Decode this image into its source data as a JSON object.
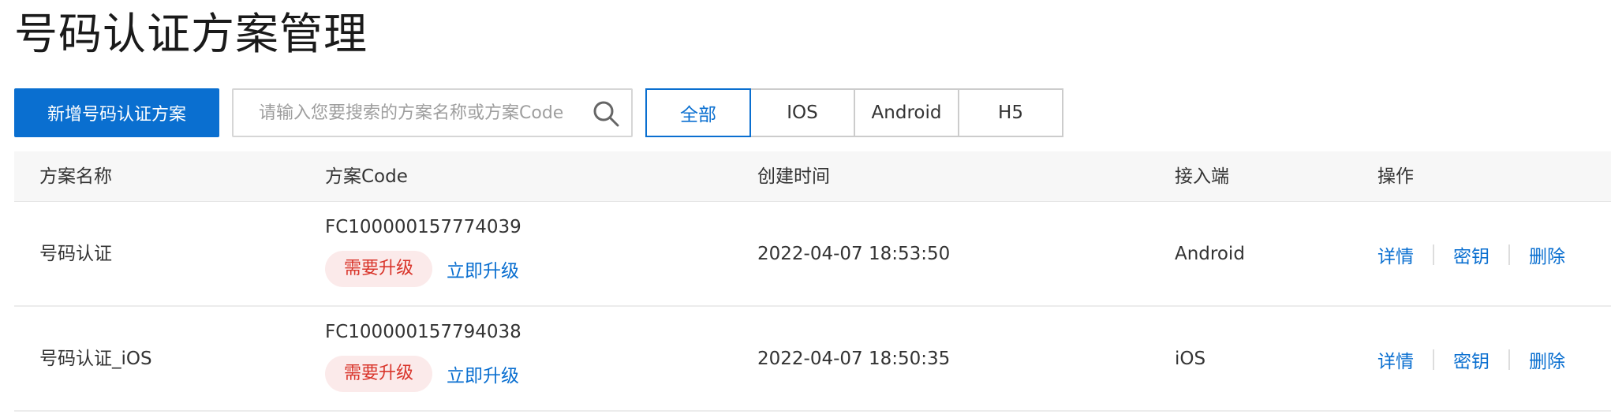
{
  "page": {
    "title": "号码认证方案管理"
  },
  "toolbar": {
    "add_button": "新增号码认证方案",
    "search": {
      "placeholder": "请输入您要搜索的方案名称或方案Code",
      "value": ""
    },
    "filters": [
      {
        "label": "全部",
        "active": true
      },
      {
        "label": "IOS",
        "active": false
      },
      {
        "label": "Android",
        "active": false
      },
      {
        "label": "H5",
        "active": false
      }
    ]
  },
  "table": {
    "columns": [
      "方案名称",
      "方案Code",
      "创建时间",
      "接入端",
      "操作"
    ],
    "rows": [
      {
        "name": "号码认证",
        "code": "FC100000157774039",
        "badge": "需要升级",
        "upgrade_link": "立即升级",
        "created": "2022-04-07 18:53:50",
        "endpoint": "Android",
        "actions": [
          "详情",
          "密钥",
          "删除"
        ]
      },
      {
        "name": "号码认证_iOS",
        "code": "FC100000157794038",
        "badge": "需要升级",
        "upgrade_link": "立即升级",
        "created": "2022-04-07 18:50:35",
        "endpoint": "iOS",
        "actions": [
          "详情",
          "密钥",
          "删除"
        ]
      }
    ]
  },
  "colors": {
    "primary": "#0a6fd0",
    "badge_bg": "#fbeaea",
    "badge_text": "#d9352b"
  }
}
